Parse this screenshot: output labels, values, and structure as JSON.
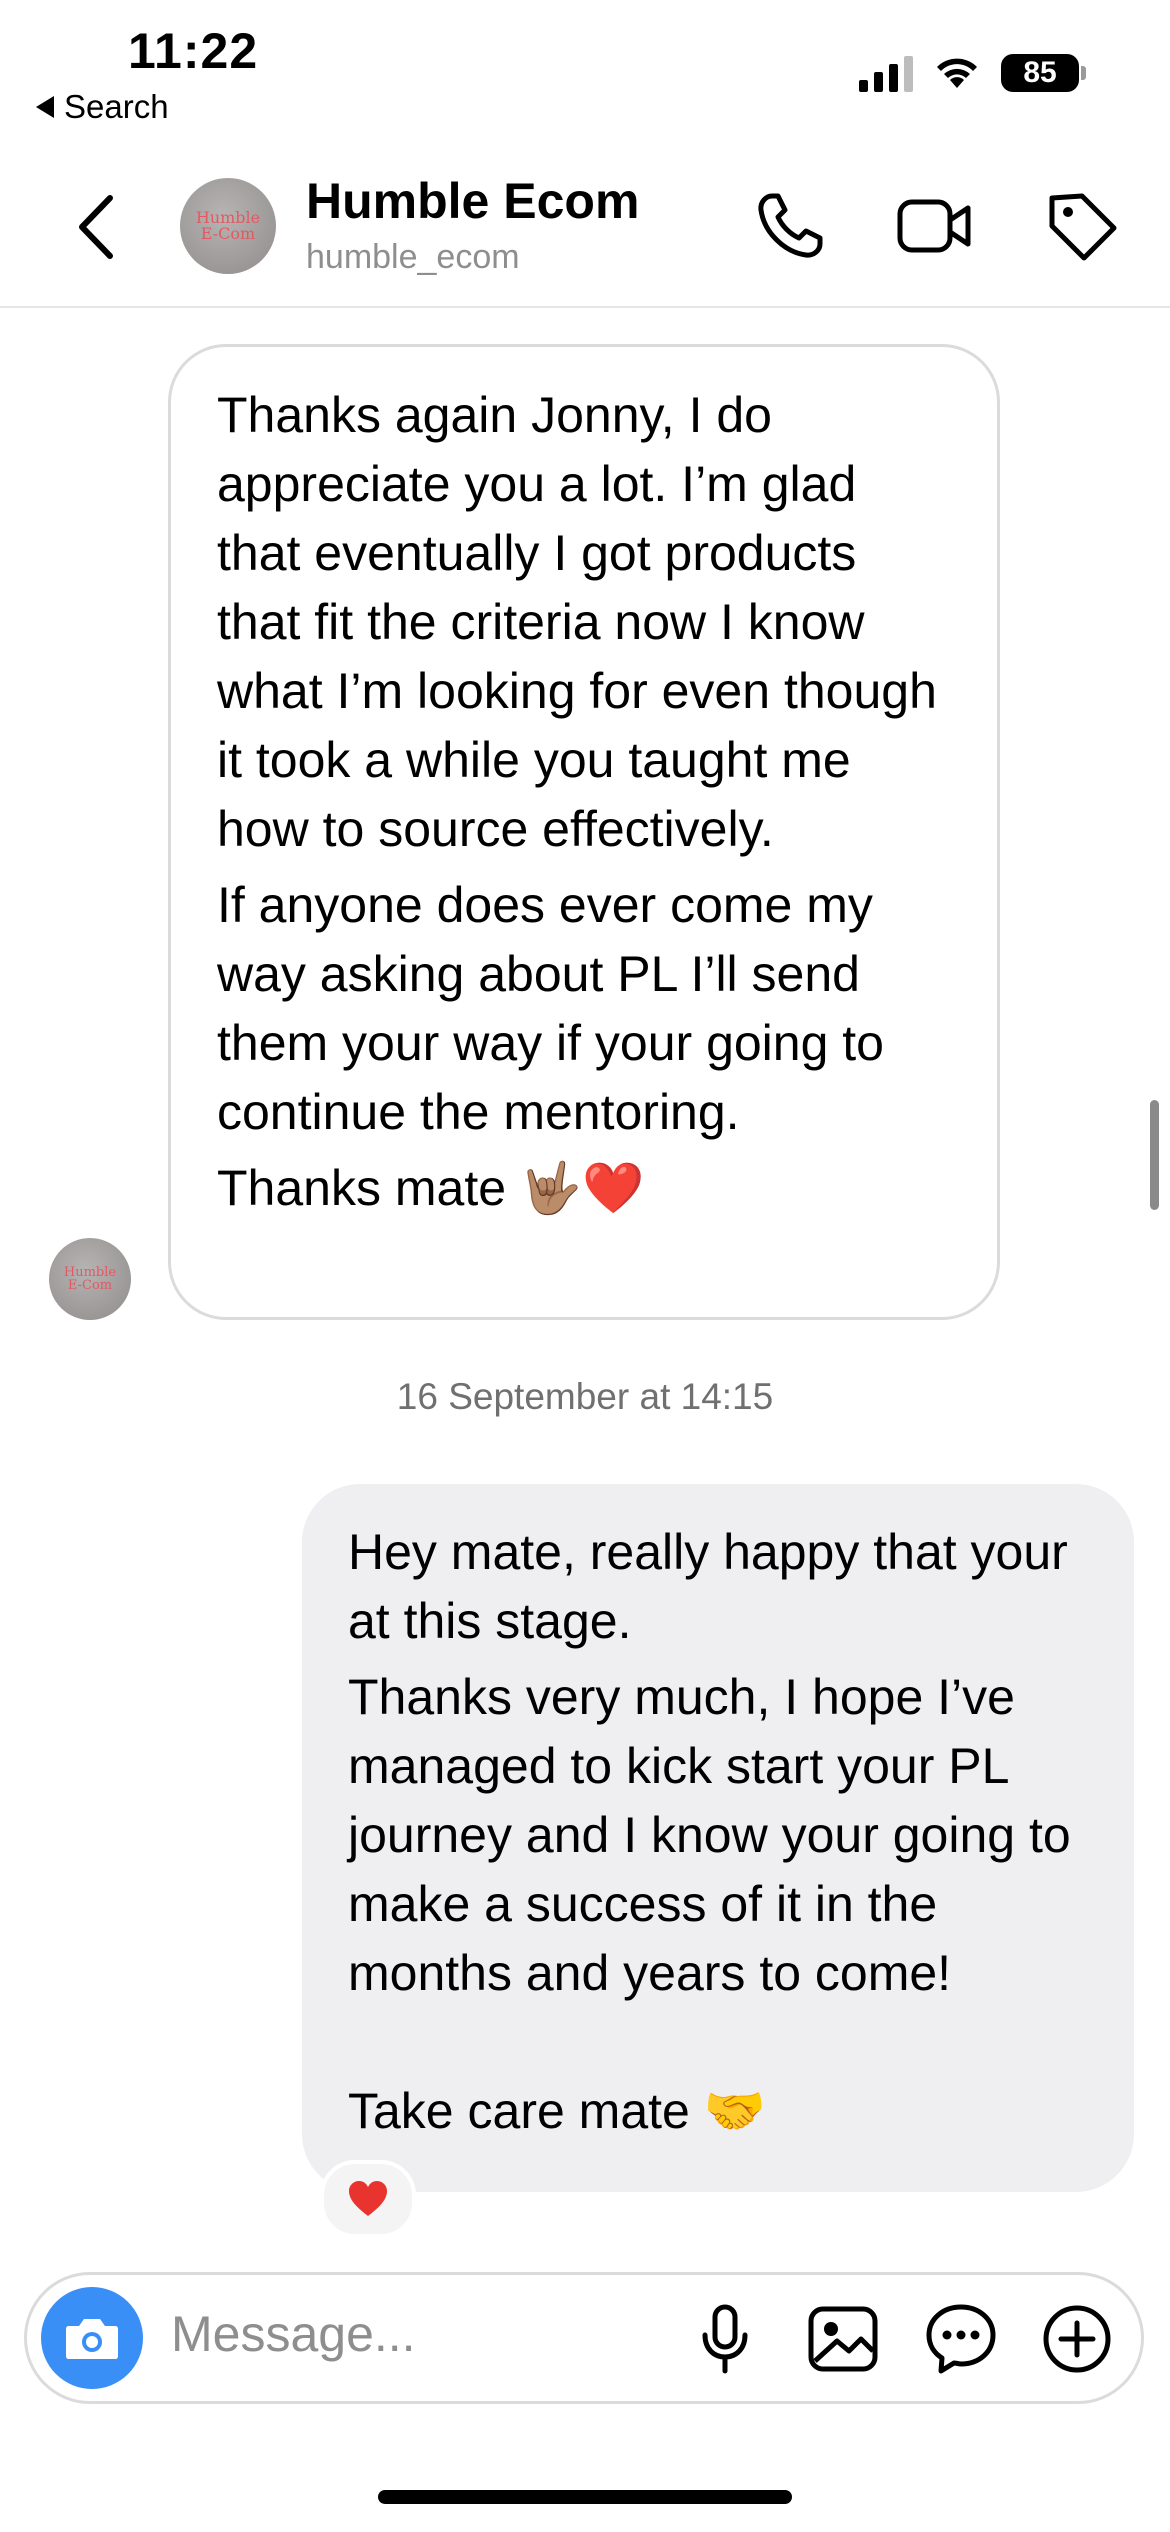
{
  "status_bar": {
    "time": "11:22",
    "back_label": "Search",
    "battery": "85"
  },
  "header": {
    "contact_name": "Humble Ecom",
    "contact_handle": "humble_ecom",
    "avatar_text_line1": "Humble",
    "avatar_text_line2": "E-Com",
    "icons": [
      "chevron-left-icon",
      "phone-icon",
      "video-camera-icon",
      "tag-icon"
    ]
  },
  "messages": [
    {
      "direction": "incoming",
      "paragraphs": [
        "Thanks again Jonny, I do appreciate you a lot. I’m glad that eventually I got products that fit the criteria now I know what I’m looking for even though it took a while you taught me how to source effectively.",
        "If anyone does ever come my way asking about PL I’ll send them your way if your going to continue the mentoring.",
        "Thanks mate 🤟🏽❤️"
      ]
    },
    {
      "direction": "outgoing",
      "paragraphs": [
        "Hey mate, really happy that your at this stage.",
        "Thanks very much, I hope I’ve managed to kick start your PL journey and I know your going to make a success of it in the months and years to come!",
        "Take care mate 🤝"
      ],
      "reaction": "❤️"
    }
  ],
  "timestamp": "16 September at 14:15",
  "composer": {
    "placeholder": "Message...",
    "icons": [
      "camera-icon",
      "microphone-icon",
      "image-icon",
      "sticker-chat-icon",
      "plus-circle-icon"
    ]
  },
  "colors": {
    "accent_blue": "#3a8ff7",
    "outgoing_bubble": "#efeef1",
    "incoming_border": "#dbdbdb"
  }
}
